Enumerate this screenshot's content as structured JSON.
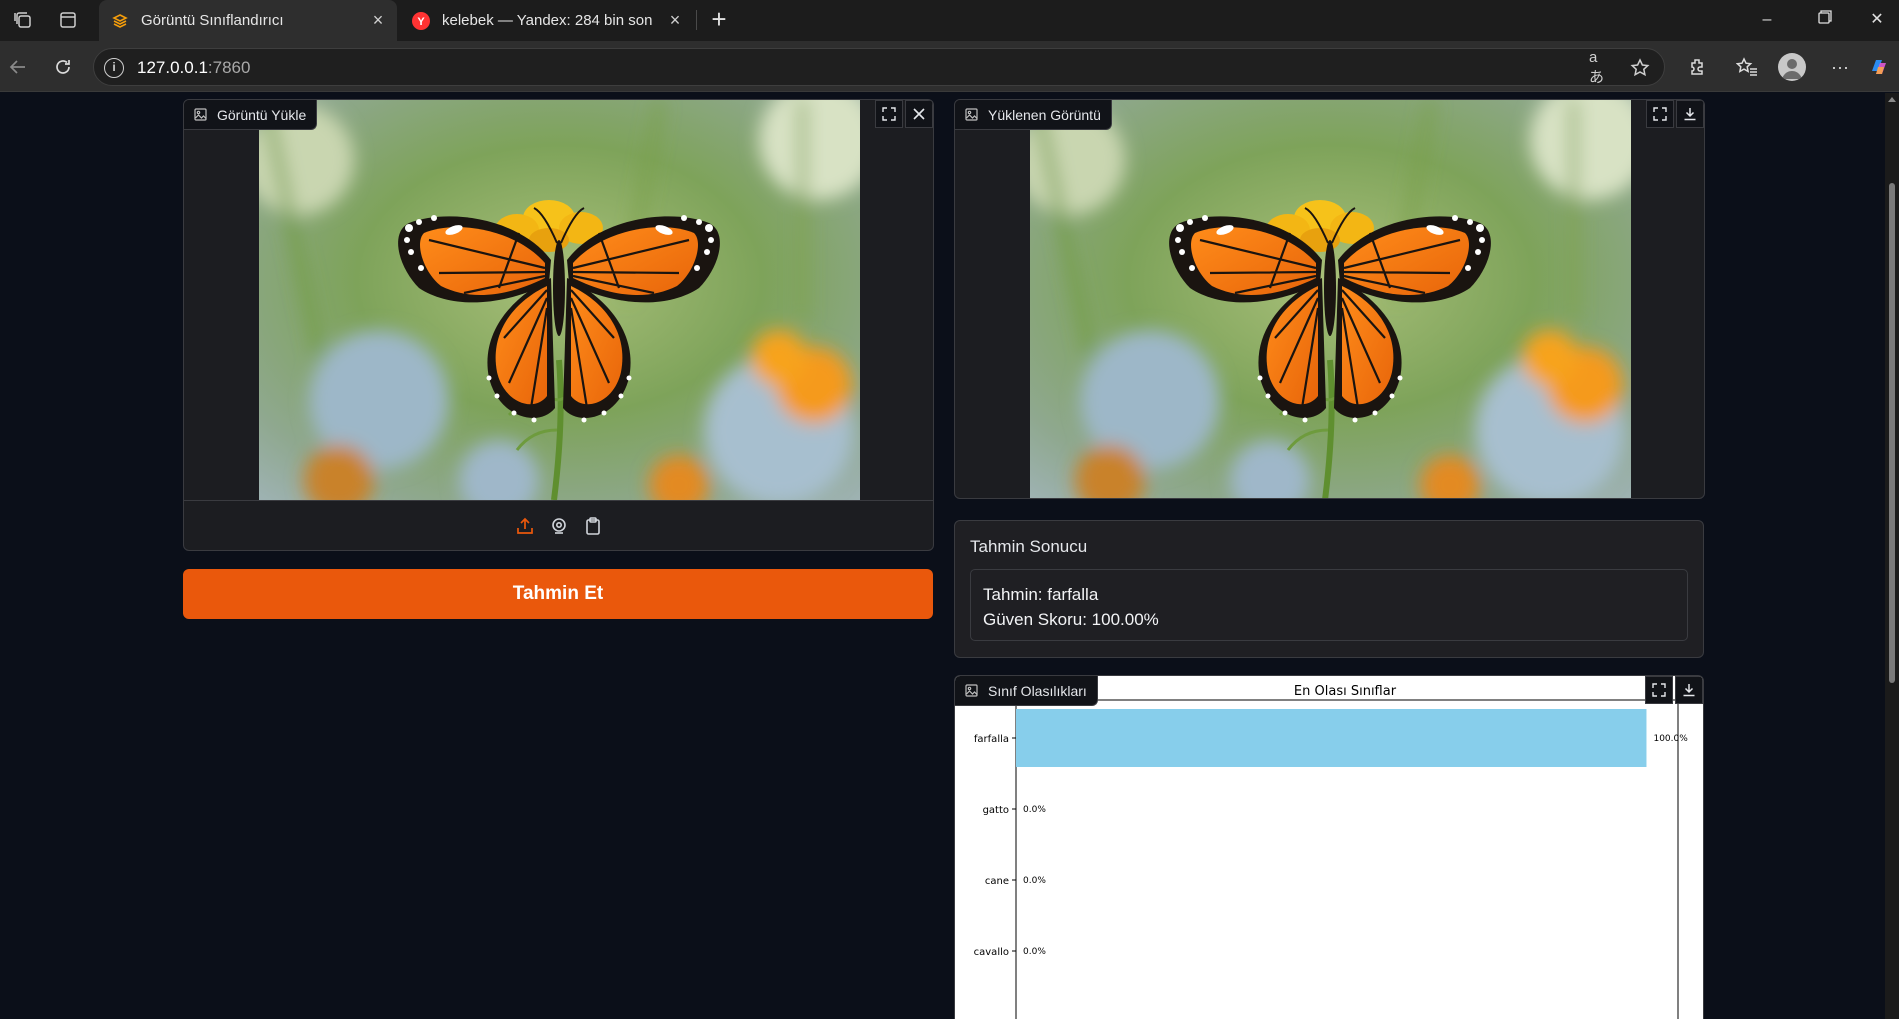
{
  "browser": {
    "tabs": [
      {
        "title": "Görüntü Sınıflandırıcı",
        "active": true,
        "icon": "gradio-logo-icon"
      },
      {
        "title": "kelebek — Yandex: 284 bin sonuç",
        "active": false,
        "icon": "yandex-icon"
      }
    ],
    "url_host": "127.0.0.1",
    "url_port": ":7860",
    "accent": "#ea580c"
  },
  "input_panel": {
    "label": "Görüntü Yükle"
  },
  "output_image": {
    "label": "Yüklenen Görüntü"
  },
  "predict_button": {
    "label": "Tahmin Et"
  },
  "result": {
    "title": "Tahmin Sonucu",
    "prediction_line": "Tahmin: farfalla",
    "score_line": "Güven Skoru: 100.00%"
  },
  "class_probs": {
    "label": "Sınıf Olasılıkları"
  },
  "chart_data": {
    "type": "bar",
    "orientation": "horizontal",
    "title": "En Olası Sınıflar",
    "categories": [
      "farfalla",
      "gatto",
      "cane",
      "cavallo"
    ],
    "values": [
      100.0,
      0.0,
      0.0,
      0.0
    ],
    "value_labels": [
      "100.0%",
      "0.0%",
      "0.0%",
      "0.0%"
    ],
    "xlim": [
      0,
      105
    ],
    "bar_color": "#87ceeb",
    "grid": false
  }
}
